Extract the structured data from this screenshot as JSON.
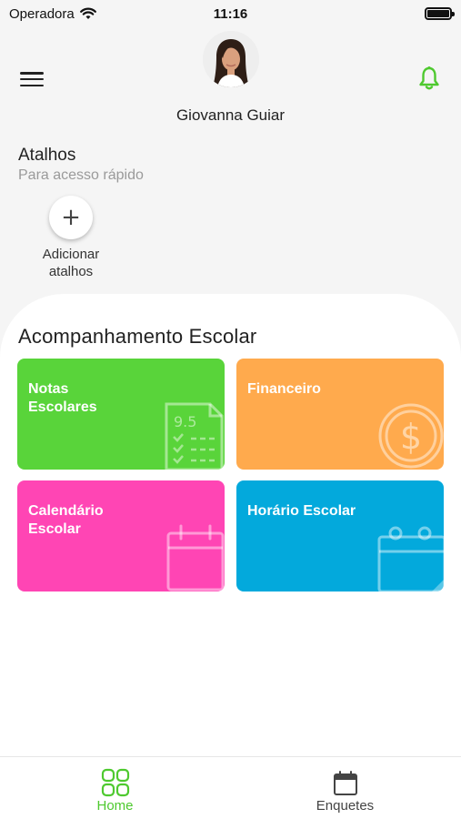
{
  "status_bar": {
    "carrier": "Operadora",
    "time": "11:16"
  },
  "header": {
    "user_name": "Giovanna Guiar"
  },
  "shortcuts": {
    "title": "Atalhos",
    "subtitle": "Para acesso rápido",
    "add_label": "Adicionar atalhos"
  },
  "main": {
    "section_title": "Acompanhamento Escolar",
    "cards": [
      {
        "label": "Notas Escolares",
        "color": "#59d43a",
        "icon": "grade-sheet-icon",
        "deco_text": "9.5"
      },
      {
        "label": "Financeiro",
        "color": "#ffaa4d",
        "icon": "dollar-coin-icon"
      },
      {
        "label": "Calendário Escolar",
        "color": "#ff45b4",
        "icon": "calendar-icon"
      },
      {
        "label": "Horário Escolar",
        "color": "#03a9dc",
        "icon": "schedule-calendar-icon"
      }
    ]
  },
  "bottom_nav": {
    "items": [
      {
        "label": "Home",
        "icon": "grid-icon",
        "active": true
      },
      {
        "label": "Enquetes",
        "icon": "calendar-icon",
        "active": false
      }
    ]
  },
  "colors": {
    "accent": "#4ec92f",
    "bell": "#4ec92f"
  }
}
